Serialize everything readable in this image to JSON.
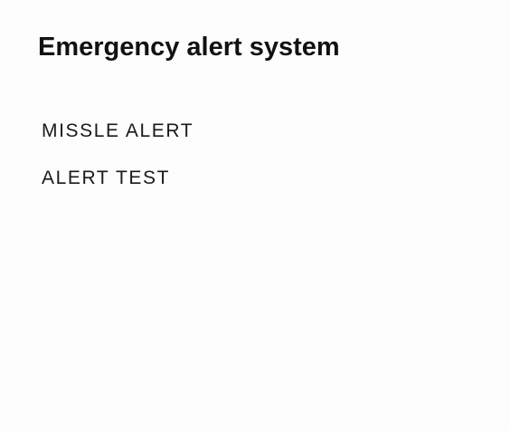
{
  "header": {
    "title": "Emergency alert system"
  },
  "alerts": {
    "items": [
      {
        "label": "MISSLE ALERT"
      },
      {
        "label": "ALERT TEST"
      }
    ]
  }
}
